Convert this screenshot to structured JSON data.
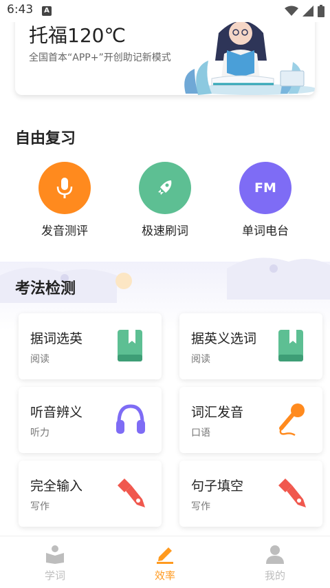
{
  "status": {
    "time": "6:43",
    "notif_letter": "A"
  },
  "hero": {
    "title": "托福120℃",
    "subtitle": "全国首本“APP+”开创助记新模式"
  },
  "review": {
    "title": "自由复习",
    "items": [
      {
        "label": "发音测评",
        "icon": "microphone-icon",
        "color": "#FF8A1E"
      },
      {
        "label": "极速刷词",
        "icon": "rocket-icon",
        "color": "#5DBF93"
      },
      {
        "label": "单词电台",
        "icon": "fm-radio-icon",
        "color": "#7E6CF5",
        "icon_text": "FM"
      }
    ]
  },
  "tests": {
    "title": "考法检测",
    "cards": [
      {
        "title": "据词选英",
        "sub": "阅读",
        "icon": "book-icon"
      },
      {
        "title": "据英义选词",
        "sub": "阅读",
        "icon": "book-icon"
      },
      {
        "title": "听音辨义",
        "sub": "听力",
        "icon": "headphones-icon"
      },
      {
        "title": "词汇发音",
        "sub": "口语",
        "icon": "microphone-icon"
      },
      {
        "title": "完全输入",
        "sub": "写作",
        "icon": "pen-nib-icon"
      },
      {
        "title": "句子填空",
        "sub": "写作",
        "icon": "pen-nib-icon"
      }
    ]
  },
  "nav": {
    "items": [
      {
        "label": "学词",
        "icon": "study-book-icon",
        "active": false
      },
      {
        "label": "效率",
        "icon": "pencil-icon",
        "active": true
      },
      {
        "label": "我的",
        "icon": "user-icon",
        "active": false
      }
    ],
    "active_color": "#FF9A1F",
    "inactive_color": "#BDBDBD"
  }
}
